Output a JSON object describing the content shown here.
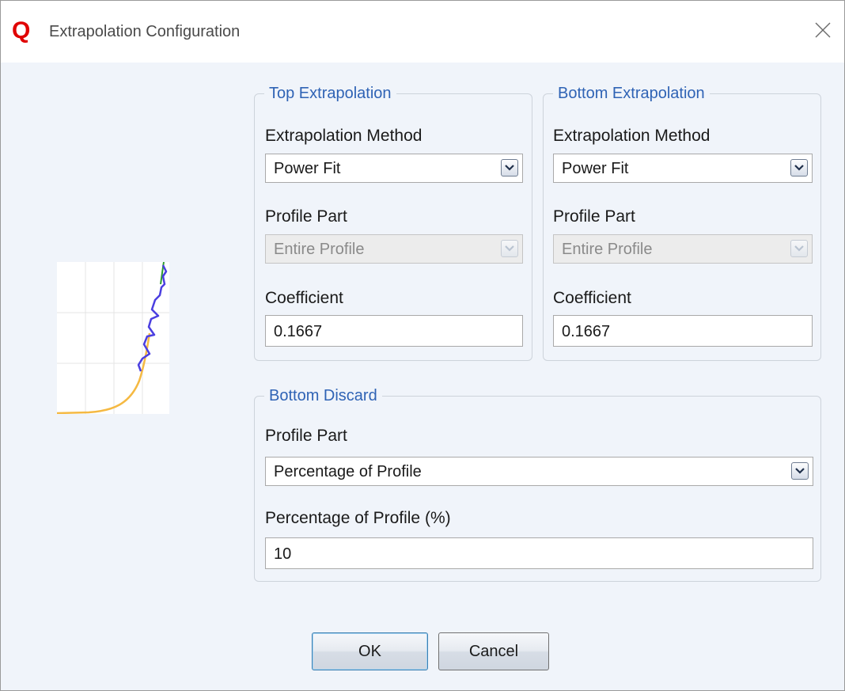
{
  "window": {
    "app_logo": "Q",
    "title": "Extrapolation Configuration",
    "close_icon": "close-icon"
  },
  "top_extrapolation": {
    "legend": "Top Extrapolation",
    "method_label": "Extrapolation Method",
    "method_value": "Power Fit",
    "profile_part_label": "Profile Part",
    "profile_part_value": "Entire Profile",
    "coefficient_label": "Coefficient",
    "coefficient_value": "0.1667"
  },
  "bottom_extrapolation": {
    "legend": "Bottom Extrapolation",
    "method_label": "Extrapolation Method",
    "method_value": "Power Fit",
    "profile_part_label": "Profile Part",
    "profile_part_value": "Entire Profile",
    "coefficient_label": "Coefficient",
    "coefficient_value": "0.1667"
  },
  "bottom_discard": {
    "legend": "Bottom Discard",
    "profile_part_label": "Profile Part",
    "profile_part_value": "Percentage of Profile",
    "percentage_label": "Percentage of Profile (%)",
    "percentage_value": "10"
  },
  "buttons": {
    "ok": "OK",
    "cancel": "Cancel"
  },
  "colors": {
    "accent": "#2f63b5",
    "logo": "#e00000",
    "measured_profile": "#4b3fe0",
    "fit_curve": "#f5b942",
    "top_curve": "#2e9b2e"
  }
}
